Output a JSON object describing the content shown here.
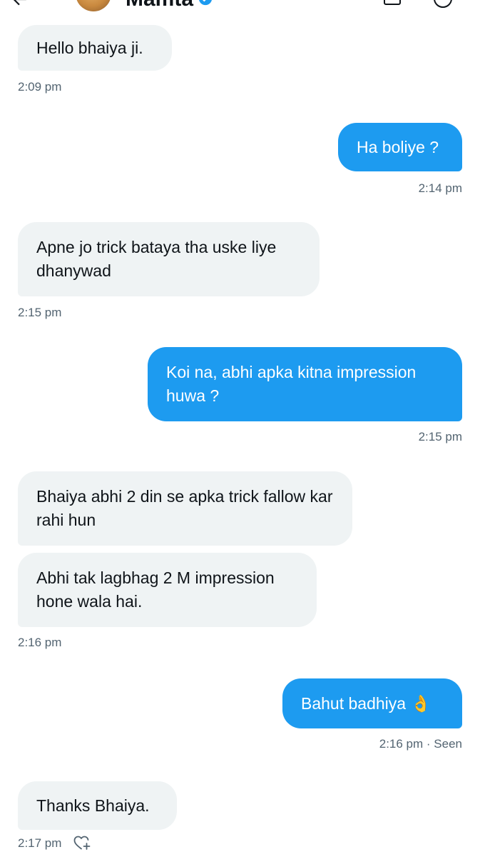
{
  "header": {
    "contact_name": "Mamta",
    "back_icon": "arrow-left-icon",
    "verified_icon": "verified-badge-icon",
    "mail_icon": "mail-settings-icon",
    "info_icon": "info-icon"
  },
  "messages": [
    {
      "direction": "in",
      "text": "Hello bhaiya ji.",
      "time": "2:09 pm"
    },
    {
      "direction": "out",
      "text": "Ha boliye ?",
      "time": "2:14 pm"
    },
    {
      "direction": "in",
      "text": "Apne jo trick bataya tha uske liye dhanywad",
      "time": "2:15 pm"
    },
    {
      "direction": "out",
      "text": "Koi na, abhi apka kitna impression huwa ?",
      "time": "2:15 pm"
    },
    {
      "direction": "in",
      "text": "Bhaiya abhi 2 din se apka trick fallow kar rahi hun"
    },
    {
      "direction": "in",
      "text": "Abhi tak lagbhag 2 M impression hone wala hai.",
      "time": "2:16 pm"
    },
    {
      "direction": "out",
      "text": "Bahut badhiya 👌",
      "time": "2:16 pm · Seen"
    },
    {
      "direction": "in",
      "text": "Thanks Bhaiya.",
      "time": "2:17 pm"
    }
  ],
  "colors": {
    "outgoing_bubble": "#1d9bf0",
    "incoming_bubble": "#eff3f4",
    "timestamp": "#536471"
  }
}
